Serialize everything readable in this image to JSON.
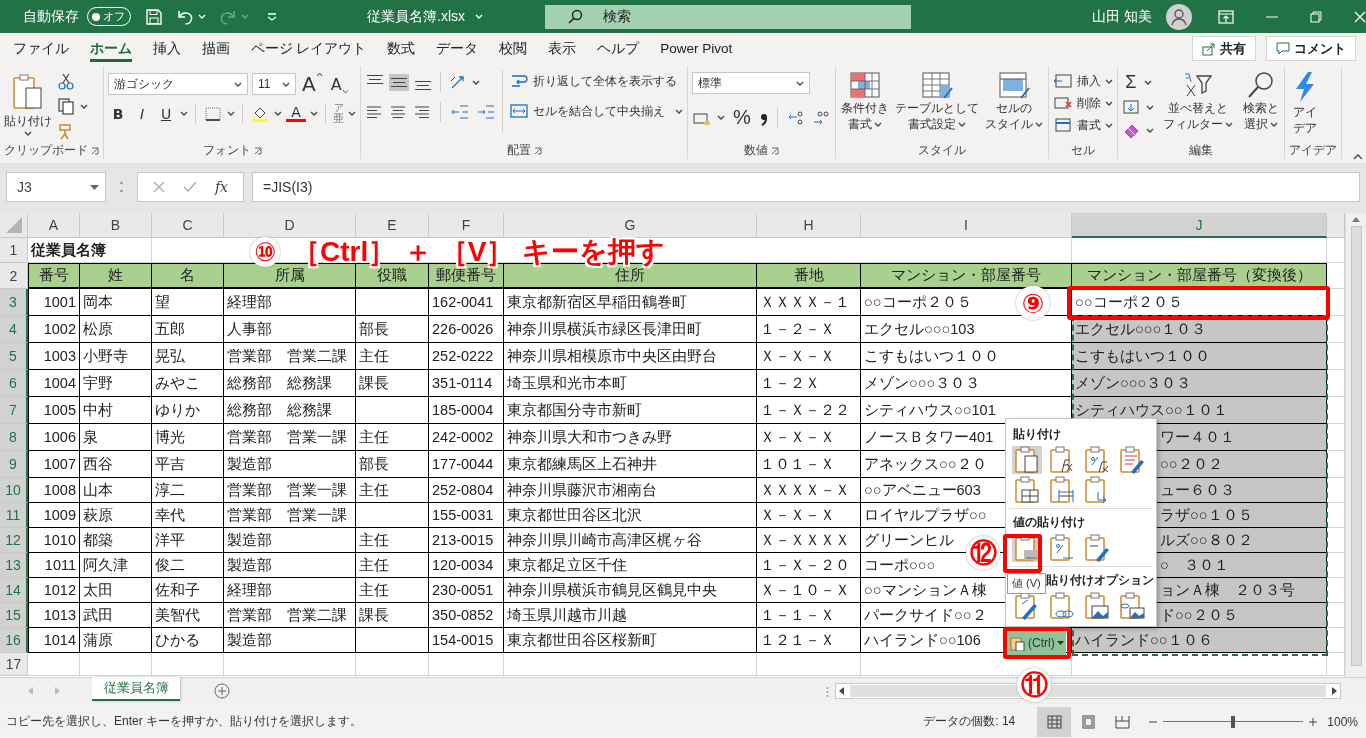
{
  "title_bar": {
    "autosave_label": "自動保存",
    "autosave_state": "オフ",
    "autosave_on": false,
    "filename": "従業員名簿.xlsx",
    "search_placeholder": "検索",
    "user_name": "山田 知美"
  },
  "menu_tabs": [
    {
      "label": "ファイル",
      "selected": false
    },
    {
      "label": "ホーム",
      "selected": true
    },
    {
      "label": "挿入",
      "selected": false
    },
    {
      "label": "描画",
      "selected": false
    },
    {
      "label": "ページ レイアウト",
      "selected": false
    },
    {
      "label": "数式",
      "selected": false
    },
    {
      "label": "データ",
      "selected": false
    },
    {
      "label": "校閲",
      "selected": false
    },
    {
      "label": "表示",
      "selected": false
    },
    {
      "label": "ヘルプ",
      "selected": false
    },
    {
      "label": "Power Pivot",
      "selected": false
    }
  ],
  "share_button": "共有",
  "comment_button": "コメント",
  "ribbon": {
    "groups": [
      {
        "label": "クリップボード",
        "paste": "貼り付け"
      },
      {
        "label": "フォント",
        "font_name": "游ゴシック",
        "font_size": "11",
        "grow": "A",
        "shrink": "A",
        "bold": "B",
        "italic": "I",
        "underline": "U",
        "font_color": "A",
        "phonetic_ruby": "ア",
        "phonetic": "亜"
      },
      {
        "label": "配置",
        "wrap_text": "折り返して全体を表示する",
        "merge_center": "セルを結合して中央揃え",
        "vertical_align": [
          {
            "selected": false
          },
          {
            "selected": true
          },
          {
            "selected": false
          }
        ]
      },
      {
        "label": "数値",
        "format": "標準",
        "percent": "%"
      },
      {
        "label": "スタイル",
        "buttons": [
          {
            "lines": [
              "条件付き",
              "書式"
            ]
          },
          {
            "lines": [
              "テーブルとして",
              "書式設定"
            ]
          },
          {
            "lines": [
              "セルの",
              "スタイル"
            ]
          }
        ]
      },
      {
        "label": "セル",
        "buttons": [
          "挿入",
          "削除",
          "書式"
        ]
      },
      {
        "label": "編集",
        "autosum": "Σ",
        "buttons": [
          {
            "lines": [
              "並べ替えと",
              "フィルター"
            ]
          },
          {
            "lines": [
              "検索と",
              "選択"
            ]
          }
        ]
      },
      {
        "label": "アイデア",
        "buttons": [
          {
            "lines": [
              "アイ",
              "デア"
            ]
          }
        ]
      }
    ]
  },
  "formula_bar": {
    "name_box": "J3",
    "function_label": "fx",
    "formula": "=JIS(I3)"
  },
  "sheet": {
    "columns": [
      {
        "label": "A",
        "selected": false
      },
      {
        "label": "B",
        "selected": false
      },
      {
        "label": "C",
        "selected": false
      },
      {
        "label": "D",
        "selected": false
      },
      {
        "label": "E",
        "selected": false
      },
      {
        "label": "F",
        "selected": false
      },
      {
        "label": "G",
        "selected": false
      },
      {
        "label": "H",
        "selected": false
      },
      {
        "label": "I",
        "selected": false
      },
      {
        "label": "J",
        "selected": true
      }
    ],
    "rows": [
      {
        "label": "1",
        "selected": false
      },
      {
        "label": "2",
        "selected": false
      },
      {
        "label": "3",
        "selected": true
      },
      {
        "label": "4",
        "selected": true
      },
      {
        "label": "5",
        "selected": true
      },
      {
        "label": "6",
        "selected": true
      },
      {
        "label": "7",
        "selected": true
      },
      {
        "label": "8",
        "selected": true
      },
      {
        "label": "9",
        "selected": true
      },
      {
        "label": "10",
        "selected": true
      },
      {
        "label": "11",
        "selected": true
      },
      {
        "label": "12",
        "selected": true
      },
      {
        "label": "13",
        "selected": true
      },
      {
        "label": "14",
        "selected": true
      },
      {
        "label": "15",
        "selected": true
      },
      {
        "label": "16",
        "selected": true
      },
      {
        "label": "17",
        "selected": false
      }
    ],
    "title": "従業員名簿",
    "headers": [
      "番号",
      "姓",
      "名",
      "所属",
      "役職",
      "郵便番号",
      "住所",
      "番地",
      "マンション・部屋番号",
      "マンション・部屋番号（変換後）"
    ],
    "records": [
      {
        "no": "1001",
        "family_name": "岡本",
        "given_name": "望",
        "department": "経理部",
        "postal_code": "162-0041",
        "address": "東京都新宿区早稲田鶴巻町",
        "block": "ＸＸＸＸ－１",
        "building": "○○コーポ２０５",
        "building_converted": "○○コーポ２０５"
      },
      {
        "no": "1002",
        "family_name": "松原",
        "given_name": "五郎",
        "department": "人事部",
        "position": "部長",
        "postal_code": "226-0026",
        "address": "神奈川県横浜市緑区長津田町",
        "block": "１－２－Ｘ",
        "building": "エクセル○○○103",
        "building_converted": "エクセル○○○１０３"
      },
      {
        "no": "1003",
        "family_name": "小野寺",
        "given_name": "晃弘",
        "department": "営業部　営業二課",
        "position": "主任",
        "postal_code": "252-0222",
        "address": "神奈川県相模原市中央区由野台",
        "block": "Ｘ－Ｘ－Ｘ",
        "building": "こすもはいつ１００",
        "building_converted": "こすもはいつ１００"
      },
      {
        "no": "1004",
        "family_name": "宇野",
        "given_name": "みやこ",
        "department": "総務部　総務課",
        "position": "課長",
        "postal_code": "351-0114",
        "address": "埼玉県和光市本町",
        "block": "１－２Ｘ",
        "building": "メゾン○○○３０３",
        "building_converted": "メゾン○○○３０３"
      },
      {
        "no": "1005",
        "family_name": "中村",
        "given_name": "ゆりか",
        "department": "総務部　総務課",
        "postal_code": "185-0004",
        "address": "東京都国分寺市新町",
        "block": "１－Ｘ－２２",
        "building": "シティハウス○○101",
        "building_converted": "シティハウス○○１０１"
      },
      {
        "no": "1006",
        "family_name": "泉",
        "given_name": "博光",
        "department": "営業部　営業一課",
        "position": "主任",
        "postal_code": "242-0002",
        "address": "神奈川県大和市つきみ野",
        "block": "Ｘ－Ｘ－Ｘ",
        "building": "ノースＢタワー401",
        "building_converted": "ワー４０１"
      },
      {
        "no": "1007",
        "family_name": "西谷",
        "given_name": "平吉",
        "department": "製造部",
        "position": "部長",
        "postal_code": "177-0044",
        "address": "東京都練馬区上石神井",
        "block": "１０１－Ｘ",
        "building": "アネックス○○２０",
        "building_converted": "○○２０２"
      },
      {
        "no": "1008",
        "family_name": "山本",
        "given_name": "淳二",
        "department": "営業部　営業一課",
        "position": "主任",
        "postal_code": "252-0804",
        "address": "神奈川県藤沢市湘南台",
        "block": "ＸＸＸＸ－Ｘ",
        "building": "○○アベニュー603",
        "building_converted": "ュー６０３"
      },
      {
        "no": "1009",
        "family_name": "萩原",
        "given_name": "幸代",
        "department": "営業部　営業一課",
        "postal_code": "155-0031",
        "address": "東京都世田谷区北沢",
        "block": "Ｘ－Ｘ－Ｘ",
        "building": "ロイヤルプラザ○○",
        "building_converted": "ラザ○○１０５"
      },
      {
        "no": "1010",
        "family_name": "都築",
        "given_name": "洋平",
        "department": "製造部",
        "position": "主任",
        "postal_code": "213-0015",
        "address": "神奈川県川崎市高津区梶ヶ谷",
        "block": "Ｘ－ＸＸＸＸ",
        "building": "グリーンヒル",
        "building_converted": "ルズ○○８０２"
      },
      {
        "no": "1011",
        "family_name": "阿久津",
        "given_name": "俊二",
        "department": "製造部",
        "position": "主任",
        "postal_code": "120-0034",
        "address": "東京都足立区千住",
        "block": "１－Ｘ－２０",
        "building": "コーポ○○○",
        "building_converted": "○　３０１"
      },
      {
        "no": "1012",
        "family_name": "太田",
        "given_name": "佐和子",
        "department": "経理部",
        "position": "主任",
        "postal_code": "230-0051",
        "address": "神奈川県横浜市鶴見区鶴見中央",
        "block": "Ｘ－１０－Ｘ",
        "building": "○○マンションＡ棟",
        "building_converted": "ョンＡ棟　２０３号"
      },
      {
        "no": "1013",
        "family_name": "武田",
        "given_name": "美智代",
        "department": "営業部　営業二課",
        "position": "課長",
        "postal_code": "350-0852",
        "address": "埼玉県川越市川越",
        "block": "１－１－Ｘ",
        "building": "パークサイド○○２",
        "building_converted": "ド○○２０５"
      },
      {
        "no": "1014",
        "family_name": "蒲原",
        "given_name": "ひかる",
        "department": "製造部",
        "postal_code": "154-0015",
        "address": "東京都世田谷区桜新町",
        "block": "１２１－Ｘ",
        "building": "ハイランド○○106",
        "building_converted": "ハイランド○○１０６"
      }
    ]
  },
  "paste_menu": {
    "sections": [
      {
        "title": "貼り付け",
        "options": [
          {
            "selected": true
          },
          {
            "selected": false
          },
          {
            "selected": false
          },
          {
            "selected": false
          },
          {
            "selected": false
          },
          {
            "selected": false
          },
          {
            "selected": false
          }
        ]
      },
      {
        "title": "値の貼り付け",
        "options": [
          {
            "selected": true
          },
          {
            "selected": false
          },
          {
            "selected": false
          }
        ]
      },
      {
        "title": "貼り付けオプション",
        "options": [
          {
            "selected": false
          },
          {
            "selected": false
          },
          {
            "selected": false
          },
          {
            "selected": false
          }
        ]
      }
    ],
    "tooltip": "値 (V)",
    "options_button": "(Ctrl)"
  },
  "annotations": {
    "instruction_step": "⑩",
    "instruction": "［Ctrl］ ＋ ［V］ キーを押す",
    "markers": [
      "⑨",
      "⑪",
      "⑫"
    ]
  },
  "sheet_tabs": [
    {
      "label": "従業員名簿",
      "selected": true
    }
  ],
  "status_bar": {
    "message": "コピー先を選択し、Enter キーを押すか、貼り付けを選択します。",
    "count": "データの個数: 14",
    "views": [
      {
        "selected": true
      },
      {
        "selected": false
      },
      {
        "selected": false
      }
    ],
    "zoom": {
      "level": 0.5,
      "reading": "100%"
    }
  }
}
